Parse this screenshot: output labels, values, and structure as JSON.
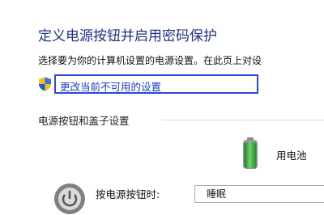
{
  "page": {
    "title": "定义电源按钮并启用密码保护",
    "description": "选择要为你的计算机设置的电源设置。在此页上对设"
  },
  "admin_link": {
    "label": "更改当前不可用的设置"
  },
  "section": {
    "label": "电源按钮和盖子设置"
  },
  "columns": {
    "battery_label": "用电池"
  },
  "row": {
    "label": "按电源按钮时:",
    "dropdown_value": "睡眠"
  },
  "colors": {
    "title": "#1e3287",
    "link": "#1a3fc8",
    "focus_border": "#2b48d6"
  }
}
